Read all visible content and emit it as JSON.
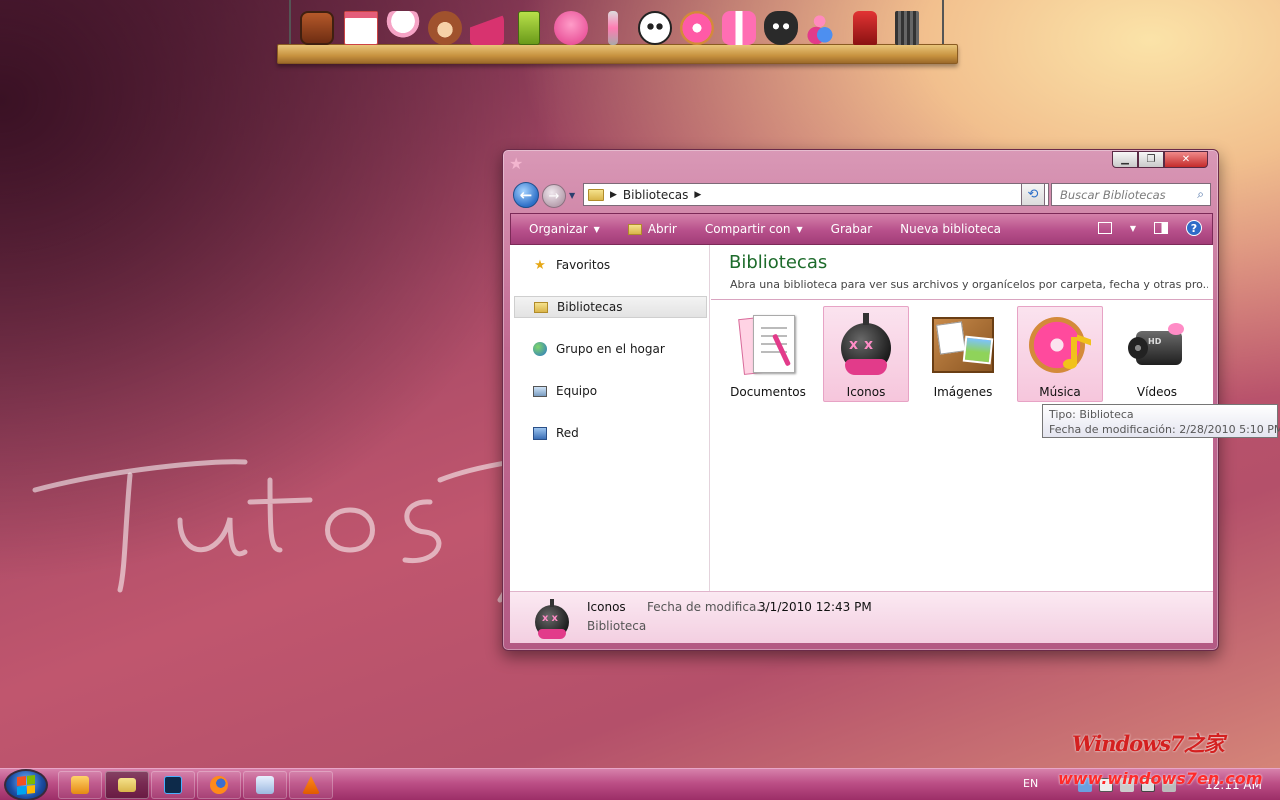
{
  "window": {
    "address_crumb": "Bibliotecas",
    "search_placeholder": "Buscar Bibliotecas"
  },
  "toolbar": {
    "organize": "Organizar",
    "open": "Abrir",
    "share": "Compartir con",
    "burn": "Grabar",
    "new_library": "Nueva biblioteca"
  },
  "navpane": {
    "items": [
      {
        "label": "Favoritos",
        "icon": "star-icon"
      },
      {
        "label": "Bibliotecas",
        "icon": "library-icon"
      },
      {
        "label": "Grupo en el hogar",
        "icon": "homegroup-icon"
      },
      {
        "label": "Equipo",
        "icon": "computer-icon"
      },
      {
        "label": "Red",
        "icon": "network-icon"
      }
    ]
  },
  "library": {
    "title": "Bibliotecas",
    "subtitle": "Abra una biblioteca para ver sus archivos y organícelos por carpeta, fecha y otras pro...",
    "tiles": [
      {
        "label": "Documentos",
        "icon": "documents-icon"
      },
      {
        "label": "Iconos",
        "icon": "bomb-icon"
      },
      {
        "label": "Imágenes",
        "icon": "pictures-icon"
      },
      {
        "label": "Música",
        "icon": "donut-music-icon"
      },
      {
        "label": "Vídeos",
        "icon": "camcorder-icon"
      }
    ]
  },
  "tooltip": {
    "type": "Tipo: Biblioteca",
    "modified": "Fecha de modificación: 2/28/2010 5:10 PM"
  },
  "details": {
    "name": "Iconos",
    "kind": "Biblioteca",
    "modified_label": "Fecha de modifica...",
    "modified_value": "3/1/2010 12:43 PM"
  },
  "watermark": {
    "text": "Tutos Invisible"
  },
  "taskbar": {
    "language": "EN",
    "clock": "12:11 AM",
    "apps": [
      "media-player-icon",
      "explorer-icon",
      "photoshop-icon",
      "firefox-icon",
      "notepad-icon",
      "vlc-icon"
    ]
  },
  "branding": {
    "logo": "Windows7之家",
    "url": "www.windows7en.com"
  },
  "colors": {
    "accent": "#b7508b",
    "library_title": "#1d6b2b",
    "selection": "#f6c6dc"
  }
}
